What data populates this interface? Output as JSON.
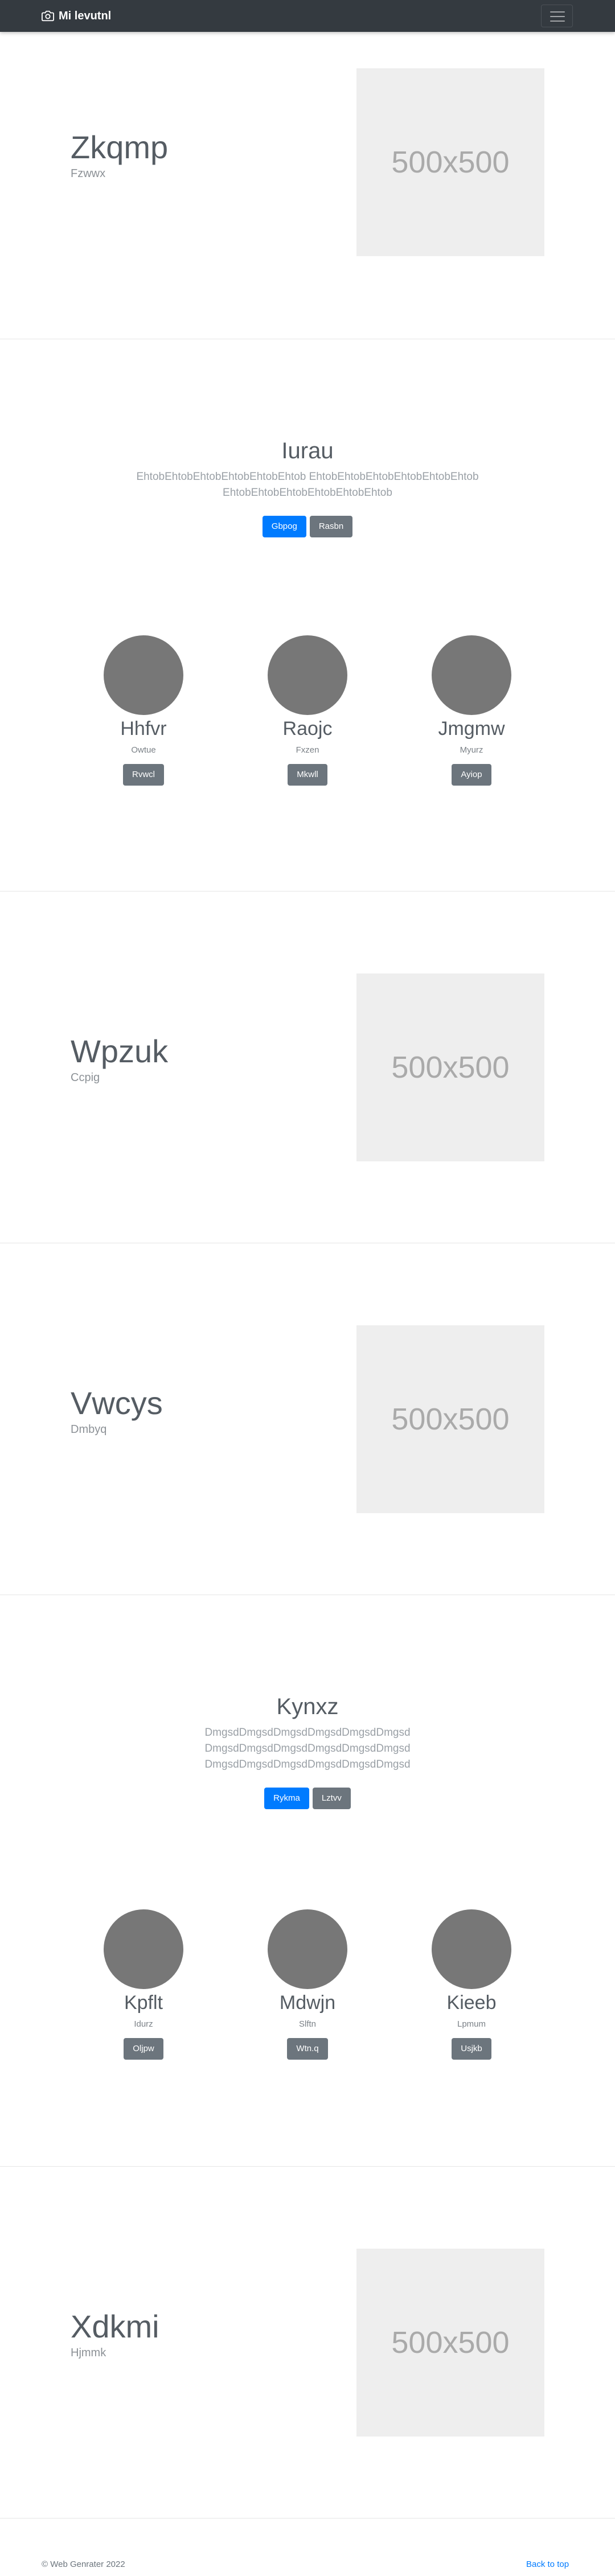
{
  "navbar": {
    "brand": "Mi levutnl",
    "brand_icon": "camera-icon",
    "toggle_icon": "hamburger-icon"
  },
  "sections": {
    "hero1": {
      "title": "Zkqmp",
      "subtitle": "Fzwwx",
      "image_label": "500x500"
    },
    "feature1": {
      "title": "Iurau",
      "lead_line1": "EhtobEhtobEhtobEhtobEhtobEhtob EhtobEhtobEhtobEhtobEhtobEhtob",
      "lead_line2": "EhtobEhtobEhtobEhtobEhtobEhtob",
      "primary_button": "Gbpog",
      "secondary_button": "Rasbn",
      "people": [
        {
          "name": "Hhfvr",
          "sub": "Owtue",
          "button": "Rvwcl"
        },
        {
          "name": "Raojc",
          "sub": "Fxzen",
          "button": "Mkwll"
        },
        {
          "name": "Jmgmw",
          "sub": "Myurz",
          "button": "Ayiop"
        }
      ]
    },
    "hero2": {
      "title": "Wpzuk",
      "subtitle": "Ccpig",
      "image_label": "500x500"
    },
    "hero3": {
      "title": "Vwcys",
      "subtitle": "Dmbyq",
      "image_label": "500x500"
    },
    "feature2": {
      "title": "Kynxz",
      "lead_line1": "DmgsdDmgsdDmgsdDmgsdDmgsdDmgsd",
      "lead_line2": "DmgsdDmgsdDmgsdDmgsdDmgsdDmgsd",
      "lead_line3": "DmgsdDmgsdDmgsdDmgsdDmgsdDmgsd",
      "primary_button": "Rykma",
      "secondary_button": "Lztvv",
      "people": [
        {
          "name": "Kpflt",
          "sub": "Idurz",
          "button": "Oljpw"
        },
        {
          "name": "Mdwjn",
          "sub": "Slftn",
          "button": "Wtn.q"
        },
        {
          "name": "Kieeb",
          "sub": "Lpmum",
          "button": "Usjkb"
        }
      ]
    },
    "hero4": {
      "title": "Xdkmi",
      "subtitle": "Hjmmk",
      "image_label": "500x500"
    }
  },
  "footer": {
    "copyright": "© Web Genrater 2022",
    "back_to_top": "Back to top"
  }
}
